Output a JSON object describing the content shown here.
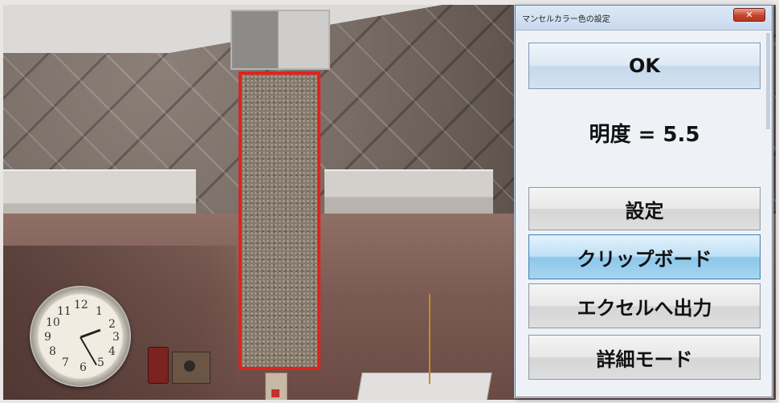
{
  "dialog": {
    "title": "マンセルカラー色の設定",
    "close_icon": "close-icon",
    "ok_label": "OK",
    "value_text": "明度 = 5.5",
    "settings_label": "設定",
    "clipboard_label": "クリップボード",
    "excel_label": "エクセルへ出力",
    "detail_label": "詳細モード"
  },
  "scene": {
    "sample_outline_color": "#e1231d",
    "clock_numbers": [
      "12",
      "1",
      "2",
      "3",
      "4",
      "5",
      "6",
      "7",
      "8",
      "9",
      "10",
      "11"
    ]
  }
}
